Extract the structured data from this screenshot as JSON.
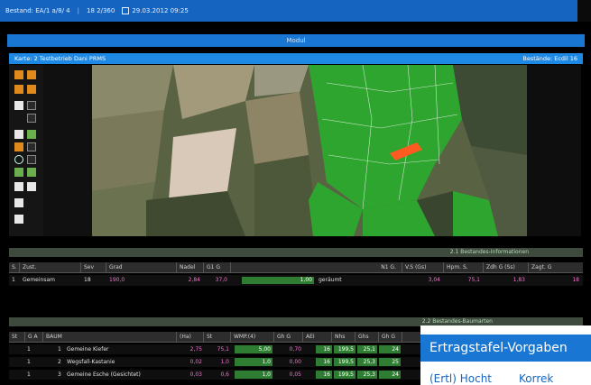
{
  "topbar": {
    "left_text": "Bestand: EA/1 a/8/ 4",
    "mid_text": "18 2/360",
    "datetime": "29.03.2012 09:25"
  },
  "modul": {
    "title": "Modul"
  },
  "map": {
    "title": "Karte: 2 Testbetrieb Dani PRMS",
    "status": "Bestände: Ecdil 16"
  },
  "toolbar": {
    "icons": [
      "select-icon",
      "highlight-icon",
      "folder-icon",
      "save-icon",
      "zoom-icon",
      "pan-icon",
      "layer-icon",
      "info-icon",
      "measure-icon",
      "polygon-icon",
      "circle-icon",
      "line-icon",
      "print-icon",
      "export-icon",
      "close-icon",
      "grid-icon",
      "settings-icon",
      "map-icon"
    ]
  },
  "section2": {
    "title": "2.1 Bestandes-Informationen",
    "headers": [
      "S.",
      "Zust.",
      "Sev",
      "Grad",
      "Nadel",
      "G1 G",
      "N1 G.",
      "V.S (Gs)",
      "Hpm. S.",
      "Zdh G (Ss)",
      "Zagt. G"
    ],
    "row": {
      "s": "1",
      "zust": "Gemeinsam",
      "sev": "18",
      "grad": "190,0",
      "nadel": "2,84",
      "g1": "37,0",
      "bar_value": "1,00",
      "status": "geräumt",
      "vs": "3,04",
      "hpm": "75,1",
      "zdh": "1,83",
      "zagt": "18"
    }
  },
  "section3": {
    "title": "2.2 Bestandes-Baumarten",
    "headers": [
      "St",
      "G A",
      "BAUM",
      "(Ha)",
      "St",
      "WMP.(4)",
      "Gh G",
      "AEI",
      "Nhs",
      "Ghs",
      "Gh G"
    ],
    "rows": [
      {
        "st": "1",
        "ga": "1",
        "name": "Gemeine Kiefer",
        "ha": "2,75",
        "s": "75,1",
        "wmp": "5,00",
        "ghg": "0,70",
        "aei": "16",
        "nhs": "199,5",
        "ghs": "25,1",
        "end": "24"
      },
      {
        "st": "1",
        "ga": "2",
        "name": "Wegsfall-Kastanie",
        "ha": "0,02",
        "s": "1,0",
        "wmp": "1,0",
        "ghg": "0,00",
        "aei": "16",
        "nhs": "199,5",
        "ghs": "25,3",
        "end": "25"
      },
      {
        "st": "1",
        "ga": "3",
        "name": "Gemeine Esche (Gesichtet)",
        "ha": "0,03",
        "s": "0,6",
        "wmp": "1,0",
        "ghg": "0,05",
        "aei": "16",
        "nhs": "199,5",
        "ghs": "25,3",
        "end": "24"
      }
    ]
  },
  "popup": {
    "title": "Ertragstafel-Vorgaben",
    "sub_left": "(Ertl) Hocht",
    "sub_right": "Korrek"
  },
  "colors": {
    "topbar": "#1565c0",
    "accent": "#1976d2",
    "forest_green": "#2ea52e",
    "selected_stand": "#ff5a1f",
    "value_pink": "#ff6ad5"
  }
}
